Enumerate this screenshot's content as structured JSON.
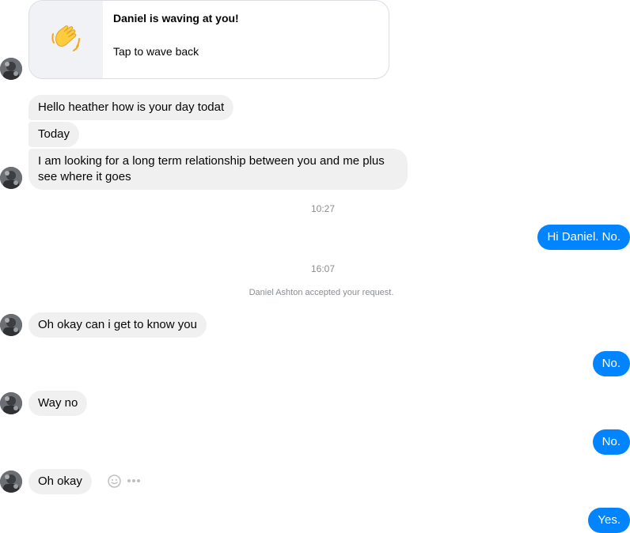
{
  "wave_card": {
    "title": "Daniel is waving at you!",
    "subtitle": "Tap to wave back",
    "icon": "waving-hand-icon"
  },
  "messages": [
    {
      "from": "them",
      "text": "Hello heather how is your day todat"
    },
    {
      "from": "them",
      "text": "Today"
    },
    {
      "from": "them",
      "text": "I am looking for a long term relationship between you and me plus see where it goes"
    },
    {
      "from": "me",
      "text": "Hi Daniel. No."
    },
    {
      "from": "them",
      "text": "Oh okay can i get to know you"
    },
    {
      "from": "me",
      "text": "No."
    },
    {
      "from": "them",
      "text": "Way no"
    },
    {
      "from": "me",
      "text": "No."
    },
    {
      "from": "them",
      "text": "Oh okay"
    },
    {
      "from": "me",
      "text": "Yes."
    }
  ],
  "timestamps": [
    "10:27",
    "16:07"
  ],
  "system_notice": "Daniel Ashton accepted your request.",
  "colors": {
    "outgoing": "#0084ff",
    "incoming": "#f0f0f0",
    "meta_text": "#8a8d91"
  },
  "hover_actions": {
    "react_icon": "smiley-icon",
    "more_icon": "more-dots-icon"
  }
}
